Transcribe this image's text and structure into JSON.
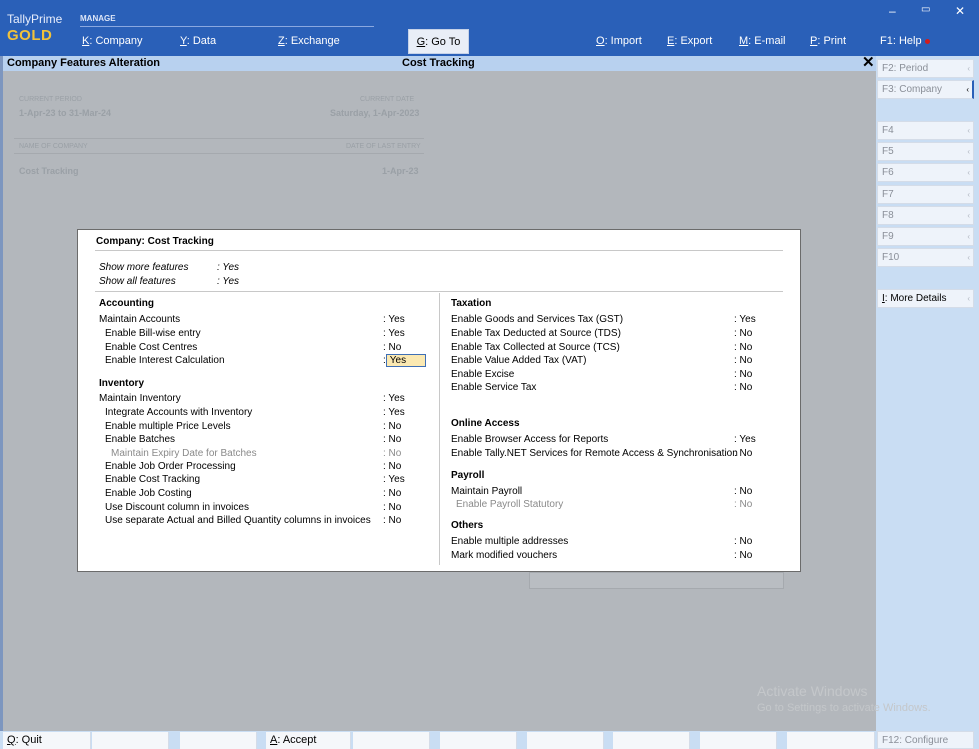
{
  "app": {
    "brand_top": "TallyPrime",
    "brand_bottom": "GOLD",
    "manage_label": "MANAGE"
  },
  "menu": [
    {
      "key": "K",
      "label": ": Company"
    },
    {
      "key": "Y",
      "label": ": Data"
    },
    {
      "key": "Z",
      "label": ": Exchange"
    },
    {
      "key": "G",
      "label": ": Go To"
    },
    {
      "key": "O",
      "label": ": Import"
    },
    {
      "key": "E",
      "label": ": Export"
    },
    {
      "key": "M",
      "label": ": E-mail"
    },
    {
      "key": "P",
      "label": ": Print"
    },
    {
      "key": "F1",
      "label": ": Help"
    }
  ],
  "window": {
    "minimize": "–",
    "restore": "▭",
    "close": "✕"
  },
  "titlebar": {
    "left": "Company Features  Alteration",
    "center": "Cost Tracking",
    "close": "✕"
  },
  "background": {
    "current_period_label": "CURRENT PERIOD",
    "current_period": "1-Apr-23 to 31-Mar-24",
    "current_date_label": "CURRENT DATE",
    "current_date": "Saturday, 1-Apr-2023",
    "company_label": "NAME OF COMPANY",
    "company": "Cost Tracking",
    "last_entry_label": "DATE OF LAST ENTRY",
    "last_entry": "1-Apr-23"
  },
  "dialog": {
    "title": "Company: Cost Tracking",
    "top_options": [
      {
        "label": "Show more features",
        "value": ": Yes"
      },
      {
        "label": "Show all features",
        "value": ": Yes"
      }
    ],
    "accounting": {
      "heading": "Accounting",
      "items": [
        {
          "label": "Maintain Accounts",
          "value": ": Yes"
        },
        {
          "label": "Enable Bill-wise entry",
          "value": ": Yes"
        },
        {
          "label": "Enable Cost Centres",
          "value": ": No"
        },
        {
          "label": "Enable Interest Calculation",
          "value": "Yes"
        }
      ]
    },
    "inventory": {
      "heading": "Inventory",
      "items": [
        {
          "label": "Maintain Inventory",
          "value": ": Yes"
        },
        {
          "label": "Integrate Accounts with Inventory",
          "value": ": Yes"
        },
        {
          "label": "Enable multiple Price Levels",
          "value": ": No"
        },
        {
          "label": "Enable Batches",
          "value": ": No"
        },
        {
          "label": "Maintain Expiry Date for Batches",
          "value": ": No"
        },
        {
          "label": "Enable Job Order Processing",
          "value": ": No"
        },
        {
          "label": "Enable Cost Tracking",
          "value": ": Yes"
        },
        {
          "label": "Enable Job Costing",
          "value": ": No"
        },
        {
          "label": "Use Discount column in invoices",
          "value": ": No"
        },
        {
          "label": "Use separate Actual and Billed Quantity columns in invoices",
          "value": ": No"
        }
      ]
    },
    "taxation": {
      "heading": "Taxation",
      "items": [
        {
          "label": "Enable Goods and Services Tax (GST)",
          "value": ": Yes"
        },
        {
          "label": "Enable Tax Deducted at Source (TDS)",
          "value": ": No"
        },
        {
          "label": "Enable Tax Collected at Source (TCS)",
          "value": ": No"
        },
        {
          "label": "Enable Value Added Tax (VAT)",
          "value": ": No"
        },
        {
          "label": "Enable Excise",
          "value": ": No"
        },
        {
          "label": "Enable Service Tax",
          "value": ": No"
        }
      ]
    },
    "online": {
      "heading": "Online Access",
      "items": [
        {
          "label": "Enable Browser Access for Reports",
          "value": ": Yes"
        },
        {
          "label": "Enable Tally.NET Services for Remote Access & Synchronisation",
          "value": ": No"
        }
      ]
    },
    "payroll": {
      "heading": "Payroll",
      "items": [
        {
          "label": "Maintain Payroll",
          "value": ": No"
        },
        {
          "label": "Enable Payroll Statutory",
          "value": ": No"
        }
      ]
    },
    "others": {
      "heading": "Others",
      "items": [
        {
          "label": "Enable multiple addresses",
          "value": ": No"
        },
        {
          "label": "Mark modified vouchers",
          "value": ": No"
        }
      ]
    }
  },
  "fkeys": [
    {
      "key": "F2",
      "label": ": Period"
    },
    {
      "key": "F3",
      "label": ": Company"
    },
    {
      "key": "F4",
      "label": ""
    },
    {
      "key": "F5",
      "label": ""
    },
    {
      "key": "F6",
      "label": ""
    },
    {
      "key": "F7",
      "label": ""
    },
    {
      "key": "F8",
      "label": ""
    },
    {
      "key": "F9",
      "label": ""
    },
    {
      "key": "F10",
      "label": ""
    },
    {
      "key": "I",
      "label": ": More Details"
    },
    {
      "key": "F12",
      "label": ": Configure"
    }
  ],
  "bottom": {
    "quit_key": "Q",
    "quit_label": ": Quit",
    "accept_key": "A",
    "accept_label": ": Accept"
  },
  "watermark": {
    "line1": "Activate Windows",
    "line2": "Go to Settings to activate Windows."
  }
}
